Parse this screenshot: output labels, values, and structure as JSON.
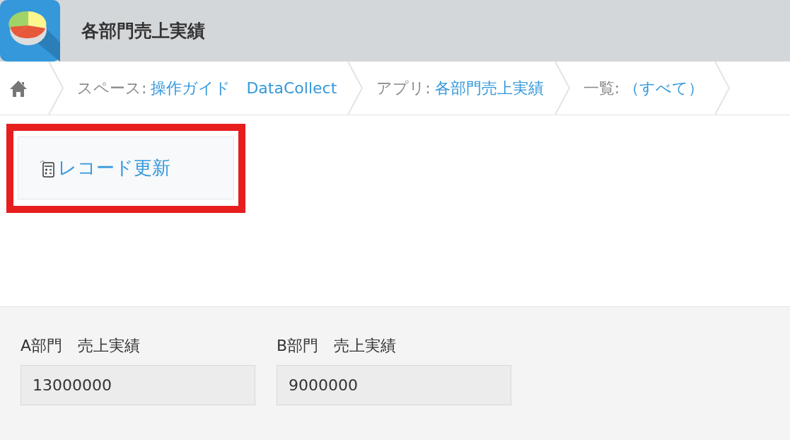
{
  "header": {
    "title": "各部門売上実績"
  },
  "breadcrumb": [
    {
      "label": "スペース:",
      "links": [
        "操作ガイド",
        "DataCollect"
      ]
    },
    {
      "label": "アプリ:",
      "links": [
        "各部門売上実績"
      ]
    },
    {
      "label": "一覧:",
      "links": [
        "（すべて）"
      ]
    }
  ],
  "action_button": {
    "label": "レコード更新",
    "highlighted": true
  },
  "fields": [
    {
      "label": "A部門　売上実績",
      "value": "13000000"
    },
    {
      "label": "B部門　売上実績",
      "value": "9000000"
    }
  ]
}
